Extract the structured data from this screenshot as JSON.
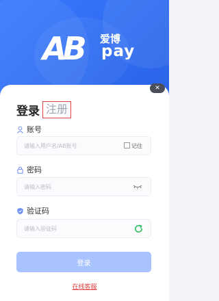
{
  "brand": {
    "logo_letters": "AB",
    "logo_cn": "爱博",
    "logo_pay": "pay"
  },
  "tabs": {
    "login": "登录",
    "register": "注册"
  },
  "account": {
    "label": "账号",
    "placeholder": "请输入用户名/AB账号",
    "remember": "记住"
  },
  "password": {
    "label": "密码",
    "placeholder": "请输入密码"
  },
  "captcha": {
    "label": "验证码",
    "placeholder": "请输入验证码"
  },
  "submit_label": "登录",
  "service_link": "在线客服",
  "colors": {
    "primary": "#2f6df2",
    "button": "#a9c3ff",
    "highlight": "#e14040",
    "refresh": "#3cbf6a"
  }
}
